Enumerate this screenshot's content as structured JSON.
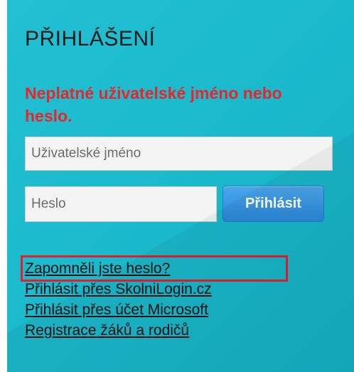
{
  "login": {
    "title": "PŘIHLÁŠENÍ",
    "error_message": "Neplatné uživatelské jméno nebo heslo.",
    "username_placeholder": "Uživatelské jméno",
    "username_value": "",
    "password_placeholder": "Heslo",
    "password_value": "",
    "submit_label": "Přihlásit"
  },
  "links": [
    {
      "label": "Zapomněli jste heslo?"
    },
    {
      "label": "Přihlásit přes SkolniLogin.cz"
    },
    {
      "label": "Přihlásit přes účet Microsoft"
    },
    {
      "label": "Registrace žáků a rodičů"
    }
  ],
  "colors": {
    "panel_background": "#1ab8cb",
    "error_text": "#e8262a",
    "button_accent": "#2a86d8",
    "highlight_box": "#e31f2c"
  }
}
